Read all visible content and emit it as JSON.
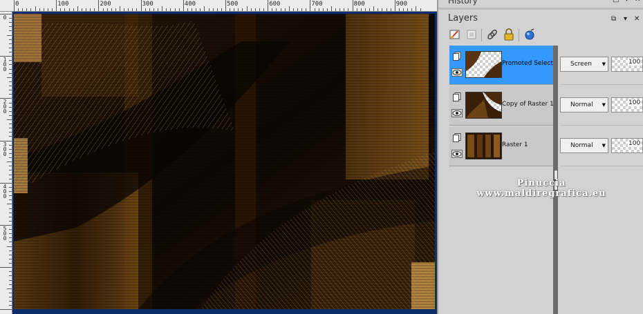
{
  "ruler": {
    "top_labels": [
      "0",
      "100",
      "200",
      "300",
      "400",
      "500",
      "600",
      "700",
      "800",
      "900"
    ],
    "left_labels": [
      "0",
      "1\n0\n0",
      "2\n0\n0",
      "3\n0\n0",
      "4\n0\n0",
      "5\n0\n0"
    ]
  },
  "history_panel": {
    "title": "History"
  },
  "layers_panel": {
    "title": "Layers",
    "toolbar_icons": [
      "paint-brush-icon",
      "layer-properties-icon",
      "link-icon",
      "lock-icon",
      "layer-style-icon"
    ],
    "layers": [
      {
        "name": "Promoted Selection",
        "blend_mode": "Screen",
        "opacity": "100",
        "selected": true
      },
      {
        "name": "Copy of Raster 1",
        "blend_mode": "Normal",
        "opacity": "100",
        "selected": false
      },
      {
        "name": "Raster 1",
        "blend_mode": "Normal",
        "opacity": "100",
        "selected": false
      }
    ]
  },
  "watermark": {
    "line1": "Pinuccia",
    "line2": "www.maldiregrafica.eu"
  },
  "colors": {
    "selected_row": "#3399ff",
    "workspace_bg": "#0b2d6e",
    "accent_gold": "#c89a55"
  }
}
